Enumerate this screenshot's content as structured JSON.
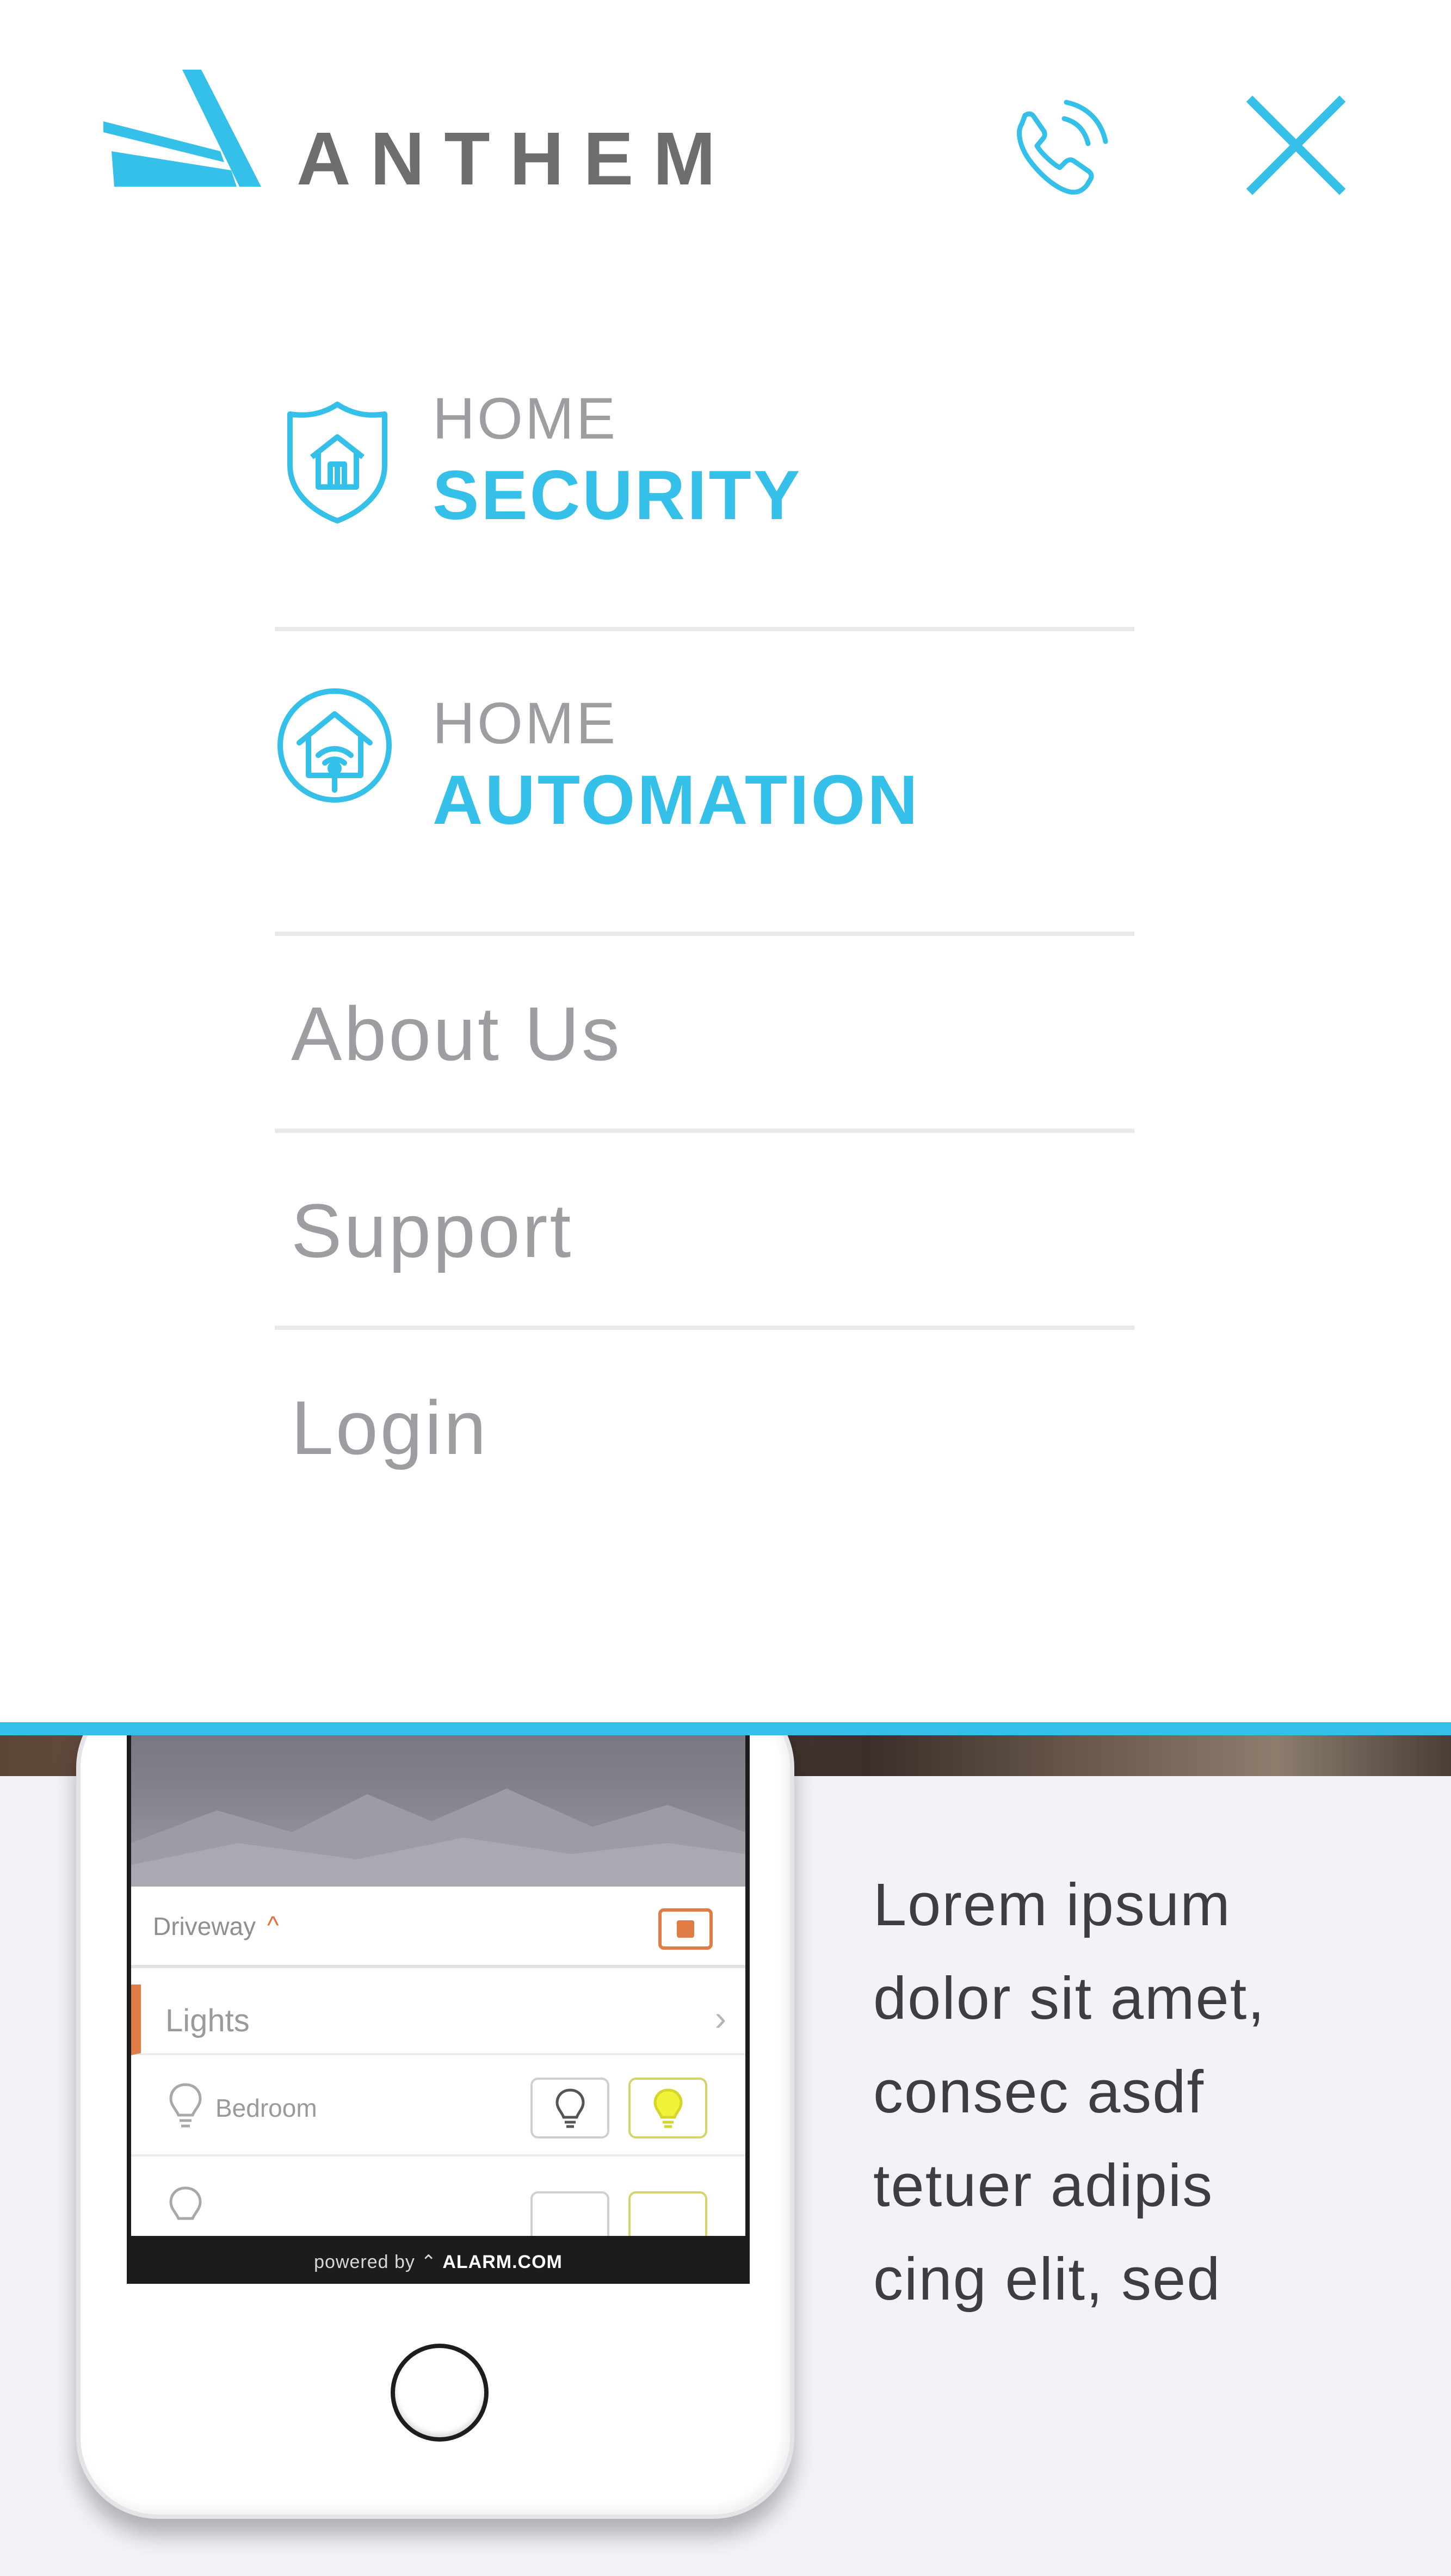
{
  "header": {
    "brand_name": "ANTHEM",
    "brand_color": "#35c0ea",
    "icons": {
      "call": "phone-call-icon",
      "close": "close-icon"
    }
  },
  "menu": {
    "items": [
      {
        "small": "HOME",
        "big": "SECURITY",
        "icon": "shield-house-icon"
      },
      {
        "small": "HOME",
        "big": "AUTOMATION",
        "icon": "smart-home-icon"
      },
      {
        "label": "About Us"
      },
      {
        "label": "Support"
      },
      {
        "label": "Login"
      }
    ]
  },
  "phone_app": {
    "camera_label": "Driveway",
    "lights_label": "Lights",
    "bedroom_label": "Bedroom",
    "powered_prefix": "powered by",
    "powered_brand": "ALARM.COM"
  },
  "content": {
    "lorem_lines": [
      "Lorem ipsum",
      "dolor sit amet,",
      "consec asdf",
      "tetuer adipis",
      "cing elit, sed"
    ]
  }
}
